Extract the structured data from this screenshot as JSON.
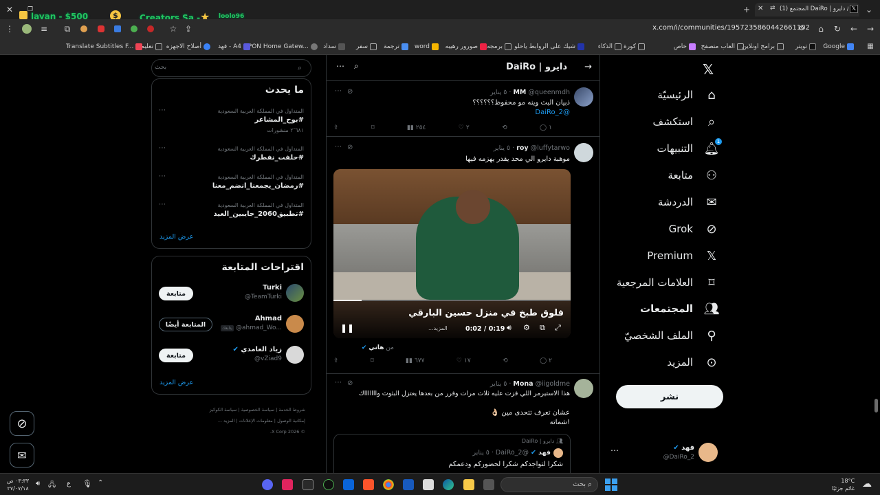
{
  "browser": {
    "tab_title": "(1) المجتمع DaiRo | دايرو / X",
    "url": "x.com/i/communities/1957235860442661102",
    "bookmarks": [
      "Google",
      "تويتر",
      "برامج اونلاين",
      "العاب متصفح",
      "خاص",
      "كورة",
      "الذكاء",
      "شيك على الروابط ياحلو",
      "برمجه",
      "صورور رهيبه",
      "word",
      "ترجمة",
      "سفر",
      "سداد",
      "GPON Home Gatew...",
      "فهد - A4",
      "أصلاح الاجهزه",
      "تعليم",
      "Translate Subtitles F..."
    ]
  },
  "overlay": {
    "left_label": "layan - $500",
    "mid_label": "Creators Sa -",
    "small_label": "loolo96"
  },
  "nav": {
    "items": [
      {
        "label": "الرئيسيّة",
        "icon": "home-icon"
      },
      {
        "label": "استكشف",
        "icon": "search-icon"
      },
      {
        "label": "التنبيهات",
        "icon": "bell-icon",
        "badge": "1"
      },
      {
        "label": "متابعة",
        "icon": "add-user-icon"
      },
      {
        "label": "الدردشة",
        "icon": "mail-icon"
      },
      {
        "label": "Grok",
        "icon": "grok-icon"
      },
      {
        "label": "Premium",
        "icon": "x-logo-icon"
      },
      {
        "label": "العلامات المرجعية",
        "icon": "bookmark-icon"
      },
      {
        "label": "المجتمعات",
        "icon": "communities-icon"
      },
      {
        "label": "الملف الشخصيّ",
        "icon": "profile-icon"
      },
      {
        "label": "المزيد",
        "icon": "more-icon"
      }
    ],
    "post_label": "نشر",
    "account_name": "فهد",
    "account_handle": "@DaiRo_2"
  },
  "center": {
    "header_title": "دايرو | DaiRo",
    "tweets": [
      {
        "name": "MM",
        "handle": "@queenmdh",
        "date": "٥ يناير",
        "text": "ذبيان البث وينه مو محفوظ؟؟؟؟؟؟",
        "mention": "@DaiRo_2",
        "replies": "١",
        "retweets": "",
        "likes": "٢",
        "views": "٢٥٤"
      },
      {
        "name": "roy",
        "handle": "@luffytarwo",
        "date": "٥ يناير",
        "text": "موهبة دايرو الي محد يقدر يهزمه فيها",
        "video_title": "فلوق طبخ في منزل حسين البارقي",
        "video_time": "0:02 / 0:19",
        "video_sub": "...المزيد",
        "via_name": "هاني",
        "via_prefix": "من",
        "replies": "٢",
        "retweets": "",
        "likes": "١٧",
        "views": "٦٧٧"
      },
      {
        "name": "Mona",
        "handle": "@iigoldme",
        "date": "٥ يناير",
        "text1": "هذا الاستيرمر اللي فزت عليه ثلاث مرات وفرر من بعدها يعتزل البثوث واااااااك",
        "text2": "عشان تعرف تتحدى مين 👌🏻",
        "text3": "!شماته",
        "quote_community": "دايرو | DaiRo",
        "quote_name": "فهد",
        "quote_handle": "@DaiRo_2",
        "quote_date": "٥ يناير",
        "quote_text": "شكرا لتواجدكم شكرا لحضوركم ودعمكم"
      }
    ]
  },
  "right": {
    "search_placeholder": "بحث",
    "trends_title": "ما يحدث",
    "trends": [
      {
        "category": "المتداول في المملكة العربية السعودية",
        "name": "#بوح_المشاعر",
        "sub": "٢٬٦٨١ منشورات"
      },
      {
        "category": "المتداول في المملكة العربية السعودية",
        "name": "#حلفت_نفطرك",
        "sub": ""
      },
      {
        "category": "المتداول في المملكة العربية السعودية",
        "name": "#رمضان_يجمعنا_انضم_معنا",
        "sub": ""
      },
      {
        "category": "المتداول في المملكة العربية السعودية",
        "name": "#تطبيق2060_جايبين_العيد",
        "sub": ""
      }
    ],
    "show_more": "عرض المزيد",
    "follow_title": "اقتراحات المتابعة",
    "suggestions": [
      {
        "name": "Turki",
        "handle": "@TeamTurki",
        "button": "متابعة",
        "follows_you": ""
      },
      {
        "name": "Ahmad",
        "handle": "@ahmad_Wo...",
        "button": "المتابعة أيضًا",
        "follows_you": "يتابعك"
      },
      {
        "name": "زياد العامدي",
        "handle": "@vZiad9",
        "button": "متابعة",
        "follows_you": ""
      }
    ],
    "show_more2": "عرض المزيد",
    "footer1": [
      "شروط الخدمة",
      "سياسة الخصوصية",
      "سياسة الكوكيز"
    ],
    "footer2": [
      "إمكانية الوصول",
      "معلومات الإعلانات",
      "المزيد ..."
    ],
    "copyright": "© 2026 X Corp."
  },
  "taskbar": {
    "search_placeholder": "بحث",
    "time": "٠٣:٣٣ ص",
    "date": "٢٧/٠٧/١٨",
    "lang": "ع",
    "weather_temp": "18°C",
    "weather_desc": "غائم جزئيًا"
  }
}
